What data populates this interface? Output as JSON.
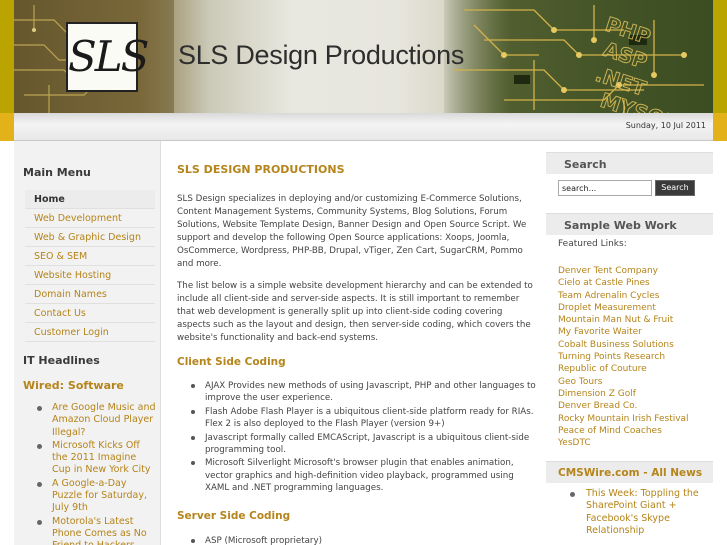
{
  "header": {
    "logo_text": "SLS",
    "site_title": "SLS Design Productions",
    "pcb_overlay_text": [
      "PHP",
      "ASP",
      ".NET",
      "MYSQL"
    ],
    "date": "Sunday, 10 Jul 2011"
  },
  "left": {
    "menu_title": "Main Menu",
    "menu_items": [
      {
        "label": "Home",
        "active": true
      },
      {
        "label": "Web Development"
      },
      {
        "label": "Web & Graphic Design"
      },
      {
        "label": "SEO & SEM"
      },
      {
        "label": "Website Hosting"
      },
      {
        "label": "Domain Names"
      },
      {
        "label": "Contact Us"
      },
      {
        "label": "Customer Login"
      }
    ],
    "it_title": "IT Headlines",
    "wired_title": "Wired: Software",
    "headlines": [
      "Are Google Music and Amazon Cloud Player Illegal?",
      "Microsoft Kicks Off the 2011 Imagine Cup in New York City",
      "A Google-a-Day Puzzle for Saturday, July 9th",
      "Motorola's Latest Phone Comes as No Friend to Hackers"
    ]
  },
  "main": {
    "title": "SLS DESIGN PRODUCTIONS",
    "p1": "SLS Design specializes in deploying and/or customizing E-Commerce Solutions, Content Management Systems, Community Systems, Blog Solutions, Forum Solutions, Website Template Design, Banner Design and Open Source Script. We support and develop the following Open Source applications: Xoops, Joomla, OsCommerce, Wordpress, PHP-BB, Drupal, vTiger, Zen Cart, SugarCRM, Pommo and more.",
    "p2": "The list below is a simple website development hierarchy and can be extended to include all client-side and server-side aspects. It is still important to remember that web development is generally split up into client-side coding covering aspects such as the layout and design, then server-side coding, which covers the website's functionality and back-end systems.",
    "client_title": "Client Side Coding",
    "client_items": [
      "AJAX Provides new methods of using Javascript, PHP and other languages to improve the user experience.",
      "Flash Adobe Flash Player is a ubiquitous client-side platform ready for RIAs. Flex 2 is also deployed to the Flash Player (version 9+)",
      "Javascript formally called EMCAScript, Javascript is a ubiquitous client-side programming tool.",
      "Microsoft Silverlight Microsoft's browser plugin that enables animation, vector graphics and high-definition video playback, programmed using XAML and .NET programming languages."
    ],
    "server_title": "Server Side Coding",
    "server_items": [
      "ASP (Microsoft proprietary)"
    ]
  },
  "right": {
    "search_title": "Search",
    "search_value": "search...",
    "search_button": "Search",
    "work_title": "Sample Web Work",
    "featured_label": "Featured Links:",
    "work_links": [
      "Denver Tent Company",
      "Cielo at Castle Pines",
      "Team Adrenalin Cycles",
      "Droplet Measurement",
      "Mountain Man Nut & Fruit",
      "My Favorite Waiter",
      "Cobalt Business Solutions",
      "Turning Points Research",
      "Republic of Couture",
      "Geo Tours",
      "Dimension Z Golf",
      "Denver Bread Co.",
      "Rocky Mountain Irish Festival",
      "Peace of Mind Coaches",
      "YesDTC"
    ],
    "cms_title": "CMSWire.com - All News",
    "cms_items": [
      "This Week: Toppling the SharePoint Giant + Facebook's Skype Relationship"
    ]
  },
  "colors": {
    "accent": "#b5841a",
    "header_gold": "#e3b21a",
    "text": "#444444"
  }
}
